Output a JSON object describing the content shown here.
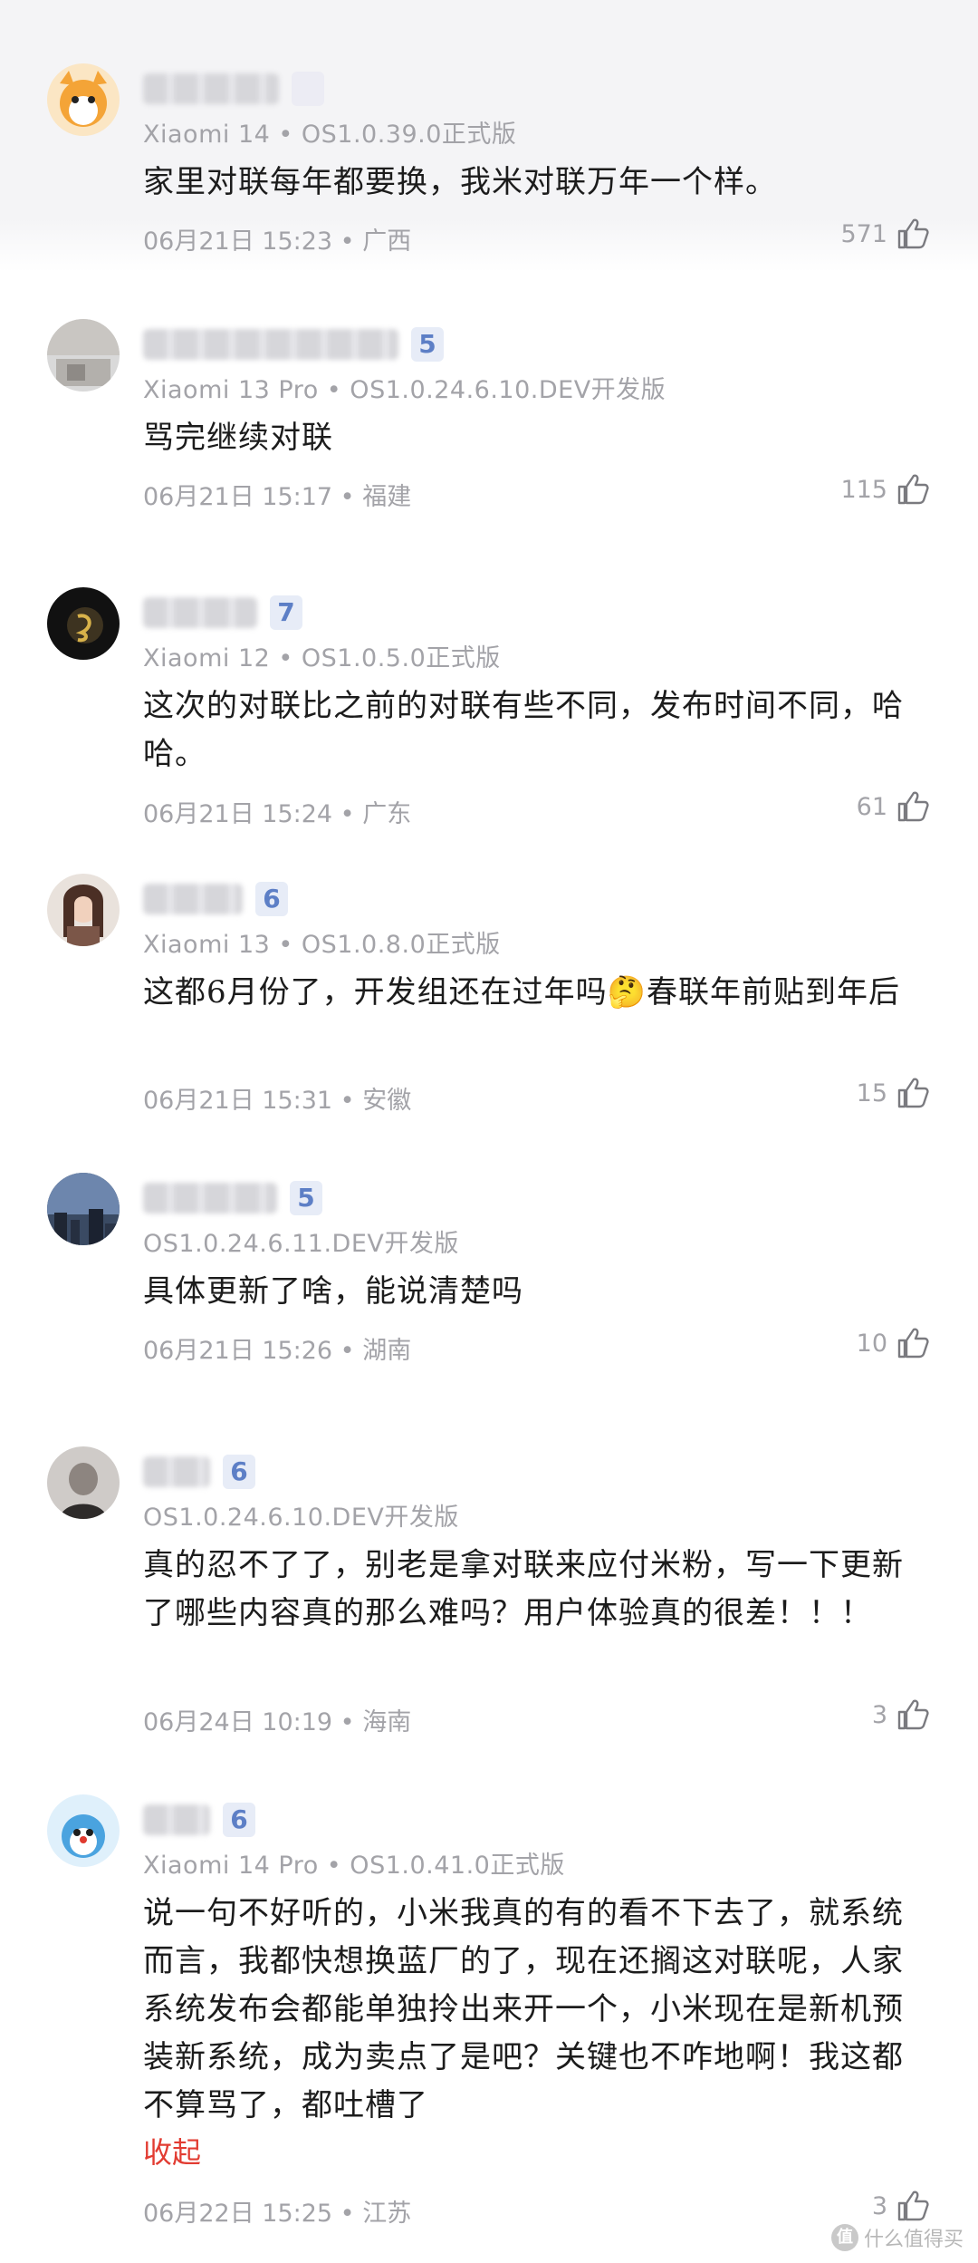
{
  "comments": [
    {
      "level": "",
      "device": "Xiaomi 14 • OS1.0.39.0正式版",
      "text": "家里对联每年都要换，我米对联万年一个样。",
      "date": "06月21日  15:23 • 广西",
      "likes": "571"
    },
    {
      "level": "5",
      "device": "Xiaomi 13 Pro • OS1.0.24.6.10.DEV开发版",
      "text": "骂完继续对联",
      "date": "06月21日  15:17 • 福建",
      "likes": "115"
    },
    {
      "level": "7",
      "device": "Xiaomi 12 • OS1.0.5.0正式版",
      "text": "这次的对联比之前的对联有些不同，发布时间不同，哈哈。",
      "date": "06月21日  15:24 • 广东",
      "likes": "61"
    },
    {
      "level": "6",
      "device": "Xiaomi 13 • OS1.0.8.0正式版",
      "text": "这都6月份了，开发组还在过年吗🤔春联年前贴到年后",
      "date": "06月21日  15:31 • 安徽",
      "likes": "15"
    },
    {
      "level": "5",
      "device": "OS1.0.24.6.11.DEV开发版",
      "text": "具体更新了啥，能说清楚吗",
      "date": "06月21日  15:26 • 湖南",
      "likes": "10"
    },
    {
      "level": "6",
      "device": "OS1.0.24.6.10.DEV开发版",
      "text": "真的忍不了了，别老是拿对联来应付米粉，写一下更新了哪些内容真的那么难吗？用户体验真的很差！！！",
      "date": "06月24日  10:19 • 海南",
      "likes": "3"
    },
    {
      "level": "6",
      "device": "Xiaomi 14 Pro • OS1.0.41.0正式版",
      "text": "说一句不好听的，小米我真的有的看不下去了，就系统而言，我都快想换蓝厂的了，现在还搁这对联呢，人家系统发布会都能单独拎出来开一个，小米现在是新机预装新系统，成为卖点了是吧？关键也不咋地啊！我这都不算骂了，都吐槽了",
      "collapse_label": "收起",
      "date": "06月22日  15:25 • 江苏",
      "likes": "3"
    }
  ],
  "watermark": {
    "icon_text": "值",
    "text": "什么值得买"
  },
  "colors": {
    "level_badge_bg": "#e7ecf7",
    "level_badge_text": "#5d7fc6",
    "collapse_red": "#e23c32",
    "meta_gray": "#a3a3a8"
  }
}
